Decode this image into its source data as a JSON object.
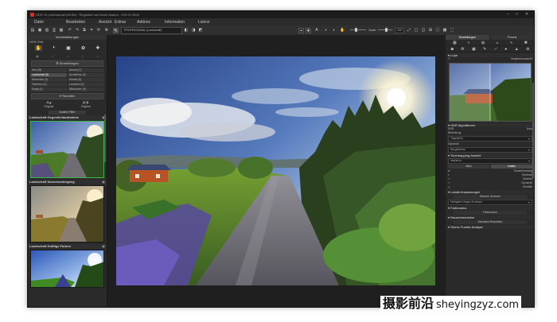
{
  "window": {
    "title": "HDR 10 professional (64 Bit) - Registriert auf Ansel Adams - V10.21.0006"
  },
  "menu": [
    "Datei",
    "Bearbeiten",
    "Ansicht",
    "Extras",
    "Addons",
    "Information",
    "Lizenz"
  ],
  "toolbar": {
    "preset_value": "PROFESSIONAL (Landschaft)",
    "zoom_label": "Zoom",
    "zoom_value": "100",
    "zoom2_value": "100"
  },
  "left": {
    "header": "Voreinstellungen",
    "hdr_stile_label": "HDR-Stile",
    "settings_label": "Einstellungen",
    "grid": [
      [
        "Alle (35)",
        "Normal (7)"
      ],
      [
        "Landschaft (8)",
        "Architektur (5)"
      ],
      [
        "Menschen (4)",
        "Kreativ (8)"
      ],
      [
        "Tierleben (4)",
        "Leuchten (3)"
      ],
      [
        "Dinge (4)",
        "Mikrokontr. (5)"
      ]
    ],
    "grid_selected": "Landschaft (8)",
    "favorites_label": "Favoriten",
    "sort_a": "Sortieren",
    "sort_b": "Sortieren",
    "tgrid": [
      "Original",
      "Original"
    ],
    "filter": "Andere Filter",
    "presets": [
      {
        "name": "Landschaft Gegenlichtaufnahme"
      },
      {
        "name": "Landschaft Sonnenuntergang"
      },
      {
        "name": "Landschaft Kräftige Farben"
      }
    ]
  },
  "right": {
    "tabs": [
      "Einstellungen",
      "Presets"
    ],
    "lupe_label": "Lupe",
    "lupe_mode": "Vergleichsansicht",
    "algo_label": "HDR Algorithmen",
    "algo_option_a": "SDR",
    "algo_option_b": "Auto",
    "belichtung_label": "Belichtung",
    "belichtung_value": "Tageslicht",
    "dynamik_label": "Dynamik",
    "dynamik_value": "Bergstrecke",
    "tonemapping_label": "Tonemapping-Ansicht",
    "tonemapping_value": "Natürlich",
    "mode_buttons": [
      "Aktiv",
      "Inaktiv"
    ],
    "controls": [
      "Tonwertumfang",
      "Kontrast",
      "Klarheit",
      "Dynamik",
      "Schärfe"
    ],
    "lokale_label": "Lokale Anpassungen",
    "lokale_btn": "Ebenen Zoomen",
    "lokale_dd": "Helligkeit Gegen Kontrast",
    "farbmodus_label": "Farbmodus",
    "farbmodus_btn": "Farbmodus",
    "rauschred_label": "Rauschreduktion",
    "rauschred_btn": "Standard Reduktion",
    "bottom_label": "Sturze Punkte-Analyse"
  },
  "watermark": {
    "cn": "摄影前沿",
    "url": "sheyingzyz.com"
  }
}
